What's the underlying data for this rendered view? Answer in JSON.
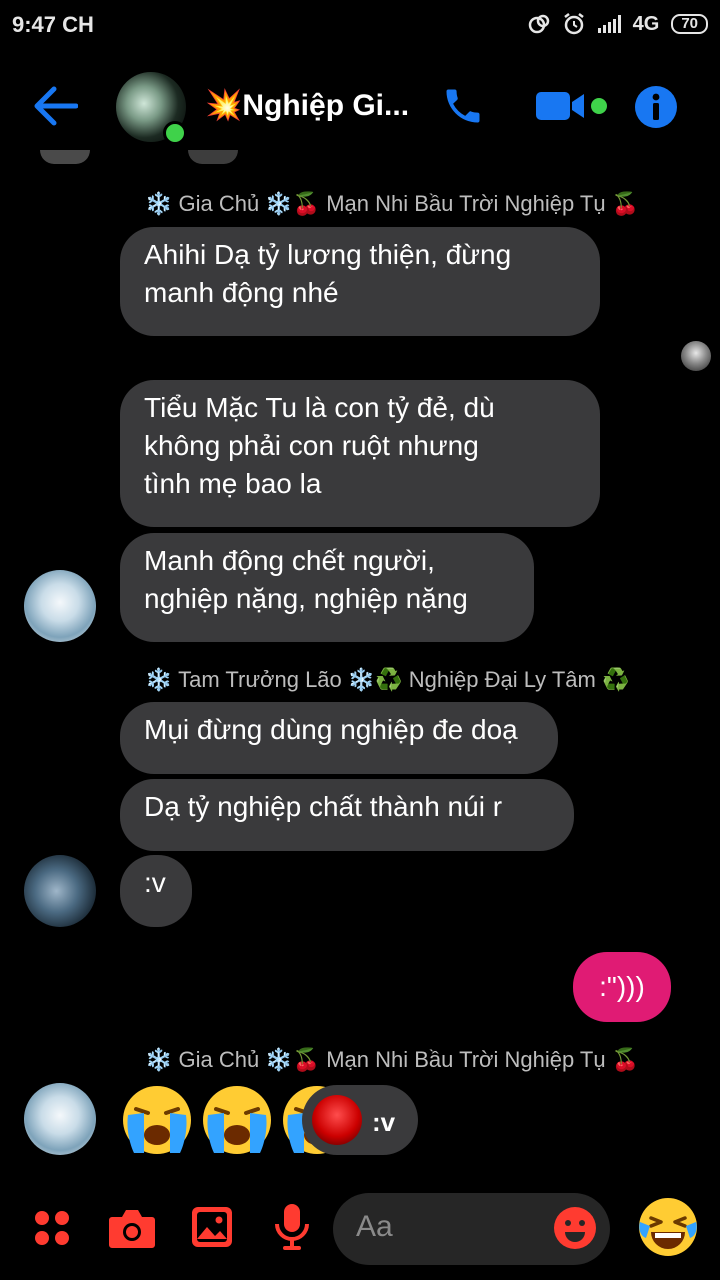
{
  "status_bar": {
    "time": "9:47 CH",
    "network": "4G",
    "battery": "70"
  },
  "header": {
    "title": "💥Nghiệp Gi..."
  },
  "messages": {
    "sender1": "❄️ Gia Chủ ❄️🍒 Mạn Nhi Bầu Trời Nghiệp Tụ 🍒",
    "m1_line1": "Ahihi Dạ tỷ lương thiện, đừng",
    "m1_line2": "manh động nhé",
    "m2_line1": "Tiểu Mặc Tu là con tỷ đẻ, dù",
    "m2_line2": "không phải con ruột nhưng",
    "m2_line3": "tình mẹ bao la",
    "m3_line1": "Manh động chết người,",
    "m3_line2": "nghiệp nặng, nghiệp nặng",
    "sender2": "❄️ Tam Trưởng Lão ❄️♻️ Nghiệp Đại Ly Tâm ♻️",
    "m4": "Mụi đừng dùng nghiệp đe doạ",
    "m5": "Dạ tỷ nghiệp chất thành núi r",
    "m6": ":v",
    "mine1": ":\")))",
    "sender3": "❄️ Gia Chủ ❄️🍒 Mạn Nhi Bầu Trời Nghiệp Tụ 🍒",
    "chathead_text": ":v"
  },
  "composer": {
    "placeholder": "Aa"
  },
  "colors": {
    "accent_blue": "#1877f2",
    "toolbar_red": "#ff3b30",
    "outgoing_bubble": "#e01b74",
    "incoming_bubble": "#3a3a3c",
    "online": "#3fd24a"
  },
  "icons": [
    "back-arrow-icon",
    "phone-icon",
    "video-call-icon",
    "info-icon",
    "apps-grid-icon",
    "camera-icon",
    "gallery-icon",
    "microphone-icon",
    "emoji-smile-icon",
    "crying-emoji-icon"
  ]
}
